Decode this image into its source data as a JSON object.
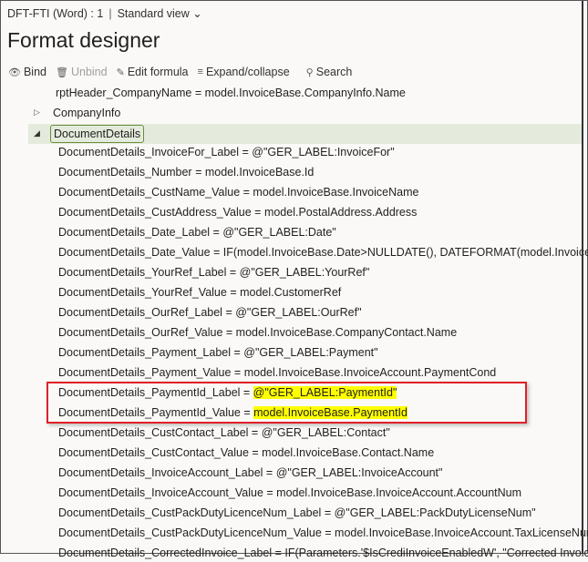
{
  "breadcrumb": {
    "record": "DFT-FTI (Word) : 1",
    "view": "Standard view",
    "chevron_icon": "chevron-down-icon"
  },
  "title": "Format designer",
  "toolbar": [
    {
      "label": "Bind",
      "icon": "eye-link-icon",
      "enabled": true
    },
    {
      "label": "Unbind",
      "icon": "trash-icon",
      "enabled": false
    },
    {
      "label": "Edit formula",
      "icon": "pencil-icon",
      "enabled": true
    },
    {
      "label": "Expand/collapse",
      "icon": "list-icon",
      "enabled": true
    },
    {
      "label": "Search",
      "icon": "search-icon",
      "enabled": true
    }
  ],
  "tree": {
    "top_line": "rptHeader_CompanyName = model.InvoiceBase.CompanyInfo.Name",
    "company_info": "CompanyInfo",
    "document_details": "DocumentDetails",
    "items": [
      {
        "name": "DocumentDetails_InvoiceFor_Label",
        "formula": "@\"GER_LABEL:InvoiceFor\""
      },
      {
        "name": "DocumentDetails_Number",
        "formula": "model.InvoiceBase.Id"
      },
      {
        "name": "DocumentDetails_CustName_Value",
        "formula": "model.InvoiceBase.InvoiceName"
      },
      {
        "name": "DocumentDetails_CustAddress_Value",
        "formula": "model.PostalAddress.Address"
      },
      {
        "name": "DocumentDetails_Date_Label",
        "formula": "@\"GER_LABEL:Date\""
      },
      {
        "name": "DocumentDetails_Date_Value",
        "formula": "IF(model.InvoiceBase.Date>NULLDATE(), DATEFORMAT(model.InvoiceB"
      },
      {
        "name": "DocumentDetails_YourRef_Label",
        "formula": "@\"GER_LABEL:YourRef\""
      },
      {
        "name": "DocumentDetails_YourRef_Value",
        "formula": "model.CustomerRef"
      },
      {
        "name": "DocumentDetails_OurRef_Label",
        "formula": "@\"GER_LABEL:OurRef\""
      },
      {
        "name": "DocumentDetails_OurRef_Value",
        "formula": "model.InvoiceBase.CompanyContact.Name"
      },
      {
        "name": "DocumentDetails_Payment_Label",
        "formula": "@\"GER_LABEL:Payment\""
      },
      {
        "name": "DocumentDetails_Payment_Value",
        "formula": "model.InvoiceBase.InvoiceAccount.PaymentCond"
      },
      {
        "name": "DocumentDetails_PaymentId_Label",
        "formula": "@\"GER_LABEL:PaymentId\"",
        "highlight": true
      },
      {
        "name": "DocumentDetails_PaymentId_Value",
        "formula": "model.InvoiceBase.PaymentId ",
        "highlight": true
      },
      {
        "name": "DocumentDetails_CustContact_Label",
        "formula": "@\"GER_LABEL:Contact\""
      },
      {
        "name": "DocumentDetails_CustContact_Value",
        "formula": "model.InvoiceBase.Contact.Name"
      },
      {
        "name": "DocumentDetails_InvoiceAccount_Label",
        "formula": "@\"GER_LABEL:InvoiceAccount\""
      },
      {
        "name": "DocumentDetails_InvoiceAccount_Value",
        "formula": "model.InvoiceBase.InvoiceAccount.AccountNum"
      },
      {
        "name": "DocumentDetails_CustPackDutyLicenceNum_Label",
        "formula": "@\"GER_LABEL:PackDutyLicenseNum\""
      },
      {
        "name": "DocumentDetails_CustPackDutyLicenceNum_Value",
        "formula": "model.InvoiceBase.InvoiceAccount.TaxLicenseNum"
      },
      {
        "name": "DocumentDetails_CorrectedInvoice_Label",
        "formula": "IF(Parameters.'$IsCrediInvoiceEnabledW', \"Corrected Invoice"
      }
    ]
  },
  "colors": {
    "highlight": "#ffff00",
    "callout_border": "#e0202a",
    "selected_row": "#e4ebdc"
  }
}
